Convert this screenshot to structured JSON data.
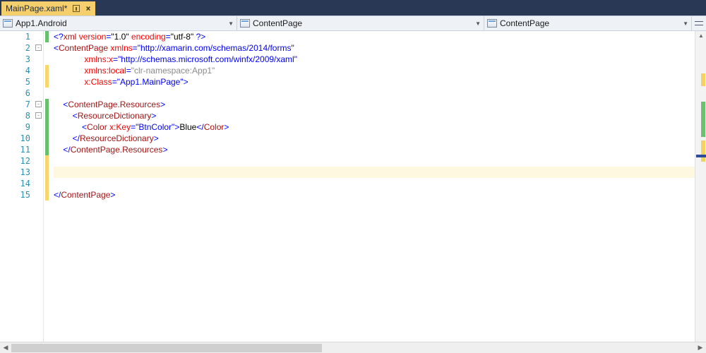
{
  "tab": {
    "title": "MainPage.xaml*",
    "close": "×"
  },
  "nav": {
    "project": "App1.Android",
    "type": "ContentPage",
    "member": "ContentPage"
  },
  "code": {
    "xml_decl": {
      "tag": "xml",
      "v_attr": "version",
      "v_val": "\"1.0\"",
      "e_attr": "encoding",
      "e_val": "\"utf-8\""
    },
    "cp_open": {
      "tag": "ContentPage",
      "a1n": "xmlns",
      "a1v": "\"http://xamarin.com/schemas/2014/forms\"",
      "a2n": "xmlns:x",
      "a2v": "\"http://schemas.microsoft.com/winfx/2009/xaml\"",
      "a3n": "xmlns:local",
      "a3v": "\"clr-namespace:App1\"",
      "a4n": "x:Class",
      "a4v": "\"App1.MainPage\""
    },
    "res_open": "ContentPage.Resources",
    "rd_open": "ResourceDictionary",
    "color": {
      "tag": "Color",
      "keyattr": "x:Key",
      "keyval": "\"BtnColor\"",
      "text": "Blue"
    },
    "rd_close": "ResourceDictionary",
    "res_close": "ContentPage.Resources",
    "cp_close": "ContentPage"
  },
  "lines": [
    "1",
    "2",
    "3",
    "4",
    "5",
    "6",
    "7",
    "8",
    "9",
    "10",
    "11",
    "12",
    "13",
    "14",
    "15"
  ]
}
